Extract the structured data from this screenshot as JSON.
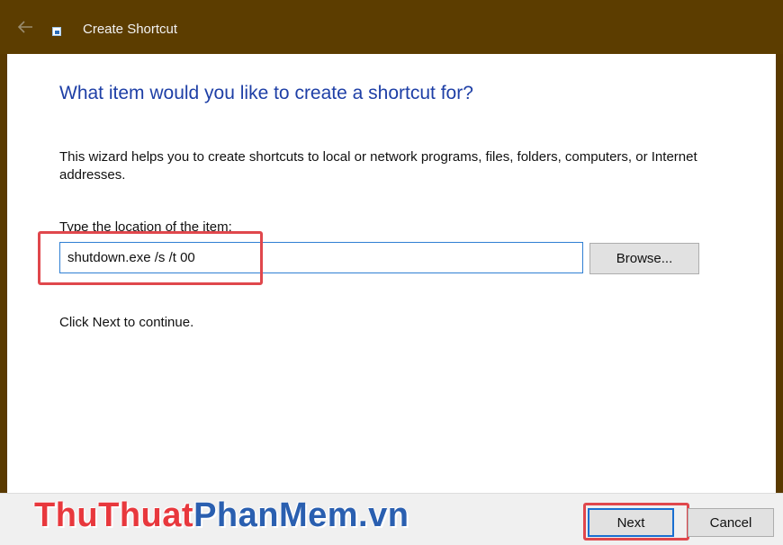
{
  "window": {
    "title": "Create Shortcut"
  },
  "wizard": {
    "heading": "What item would you like to create a shortcut for?",
    "description": "This wizard helps you to create shortcuts to local or network programs, files, folders, computers, or Internet addresses.",
    "location_label": "Type the location of the item:",
    "location_value": "shutdown.exe /s /t 00",
    "browse_label": "Browse...",
    "continue_text": "Click Next to continue."
  },
  "footer": {
    "next_label": "Next",
    "cancel_label": "Cancel"
  },
  "watermark": {
    "part1": "ThuThuat",
    "part2": "PhanMem",
    "part3": ".vn"
  },
  "icons": {
    "back": "back-arrow-icon",
    "app": "shortcut-app-icon"
  },
  "colors": {
    "titlebar": "#5c3d00",
    "heading": "#1e3fa6",
    "highlight": "#e0474c",
    "input_border": "#2f7fd3"
  }
}
